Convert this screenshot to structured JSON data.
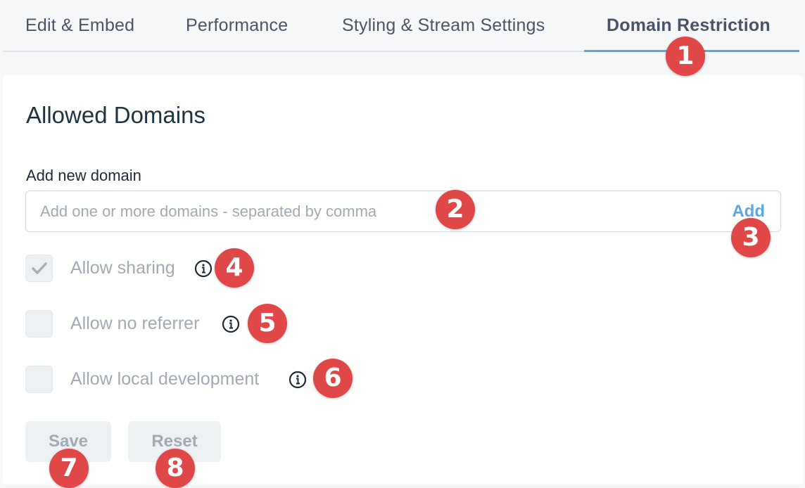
{
  "tabs": [
    {
      "label": "Edit & Embed",
      "active": false
    },
    {
      "label": "Performance",
      "active": false
    },
    {
      "label": "Styling & Stream Settings",
      "active": false
    },
    {
      "label": "Domain Restriction",
      "active": true
    }
  ],
  "section": {
    "title": "Allowed Domains"
  },
  "domain_field": {
    "label": "Add new domain",
    "value": "",
    "placeholder": "Add one or more domains - separated by comma",
    "add_label": "Add"
  },
  "options": [
    {
      "label": "Allow sharing",
      "checked": true
    },
    {
      "label": "Allow no referrer",
      "checked": false
    },
    {
      "label": "Allow local development",
      "checked": false
    }
  ],
  "buttons": {
    "save": "Save",
    "reset": "Reset"
  },
  "badges": [
    "1",
    "2",
    "3",
    "4",
    "5",
    "6",
    "7",
    "8"
  ],
  "colors": {
    "accent": "#5aa7e6",
    "badge": "#e04848",
    "disabled_text": "#a2aab4",
    "title": "#1d3340"
  },
  "icons": {
    "info": "info-circle-icon",
    "check": "checkmark-icon"
  }
}
